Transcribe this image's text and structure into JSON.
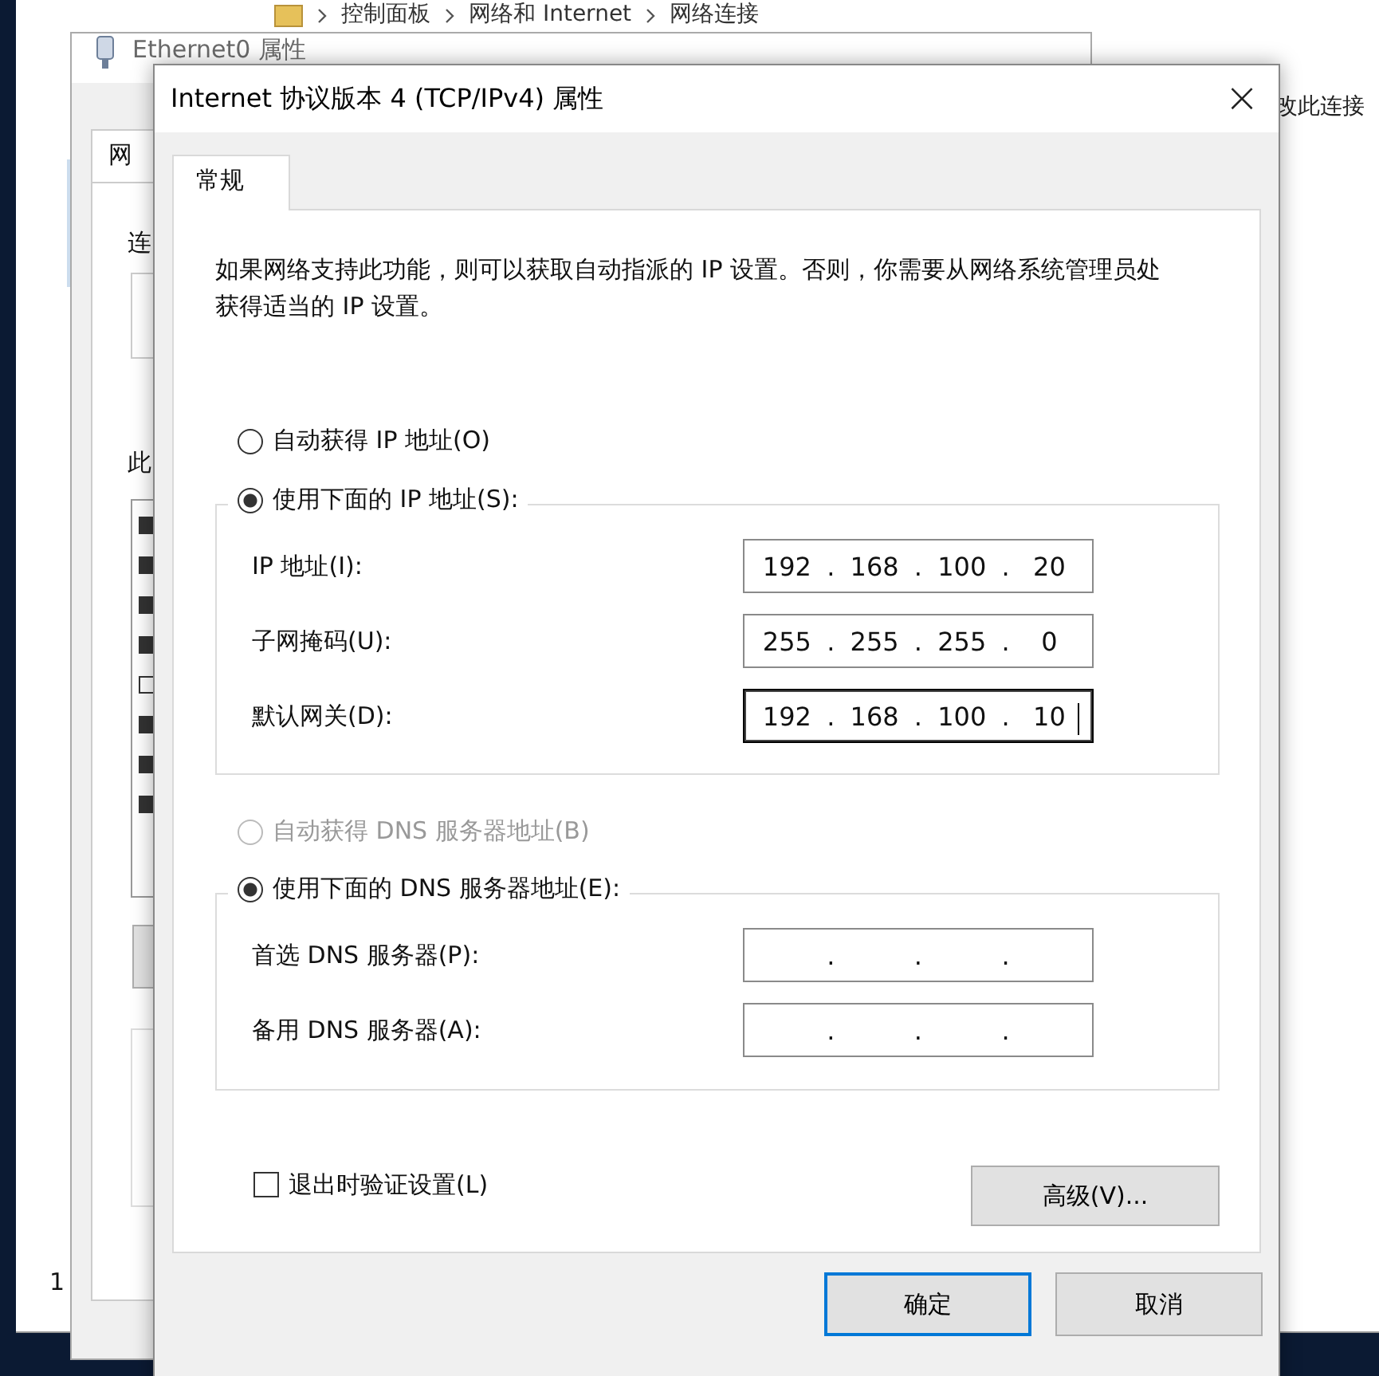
{
  "background": {
    "breadcrumb": [
      "控制面板",
      "网络和 Internet",
      "网络连接"
    ],
    "toolbar_text": "改此连接",
    "side_text": "1",
    "ethernet_window": {
      "title": "Ethernet0 属性",
      "tab": "网",
      "label_1": "连",
      "label_2": "此",
      "checkboxes": [
        {
          "checked": true
        },
        {
          "checked": true
        },
        {
          "checked": true
        },
        {
          "checked": true
        },
        {
          "checked": false
        },
        {
          "checked": true
        },
        {
          "checked": true
        },
        {
          "checked": true
        }
      ]
    }
  },
  "dialog": {
    "title": "Internet 协议版本 4 (TCP/IPv4) 属性",
    "close": "×",
    "tabs": [
      {
        "label": "常规",
        "selected": true
      }
    ],
    "description": "如果网络支持此功能，则可以获取自动指派的 IP 设置。否则，你需要从网络系统管理员处获得适当的 IP 设置。",
    "ip_options": [
      {
        "label": "自动获得 IP 地址(O)",
        "selected": false,
        "disabled": false
      },
      {
        "label": "使用下面的 IP 地址(S):",
        "selected": true,
        "disabled": false
      }
    ],
    "ip_fields": [
      {
        "label": "IP 地址(I):",
        "value": [
          "192",
          "168",
          "100",
          "20"
        ],
        "dots": [
          ".",
          ".",
          "."
        ],
        "focused": false
      },
      {
        "label": "子网掩码(U):",
        "value": [
          "255",
          "255",
          "255",
          "0"
        ],
        "dots": [
          ".",
          ".",
          "."
        ],
        "focused": false
      },
      {
        "label": "默认网关(D):",
        "value": [
          "192",
          "168",
          "100",
          "10"
        ],
        "dots": [
          ".",
          ".",
          "."
        ],
        "focused": true
      }
    ],
    "dns_options": [
      {
        "label": "自动获得 DNS 服务器地址(B)",
        "selected": false,
        "disabled": true
      },
      {
        "label": "使用下面的 DNS 服务器地址(E):",
        "selected": true,
        "disabled": false
      }
    ],
    "dns_fields": [
      {
        "label": "首选 DNS 服务器(P):",
        "dots": [
          ".",
          ".",
          "."
        ],
        "focused": false
      },
      {
        "label": "备用 DNS 服务器(A):",
        "dots": [
          ".",
          ".",
          "."
        ],
        "focused": false
      }
    ],
    "validate_checkbox": {
      "label": "退出时验证设置(L)",
      "checked": false
    },
    "advanced_button": "高级(V)...",
    "buttons": [
      {
        "label": "确定",
        "default": true
      },
      {
        "label": "取消",
        "default": false
      }
    ]
  }
}
